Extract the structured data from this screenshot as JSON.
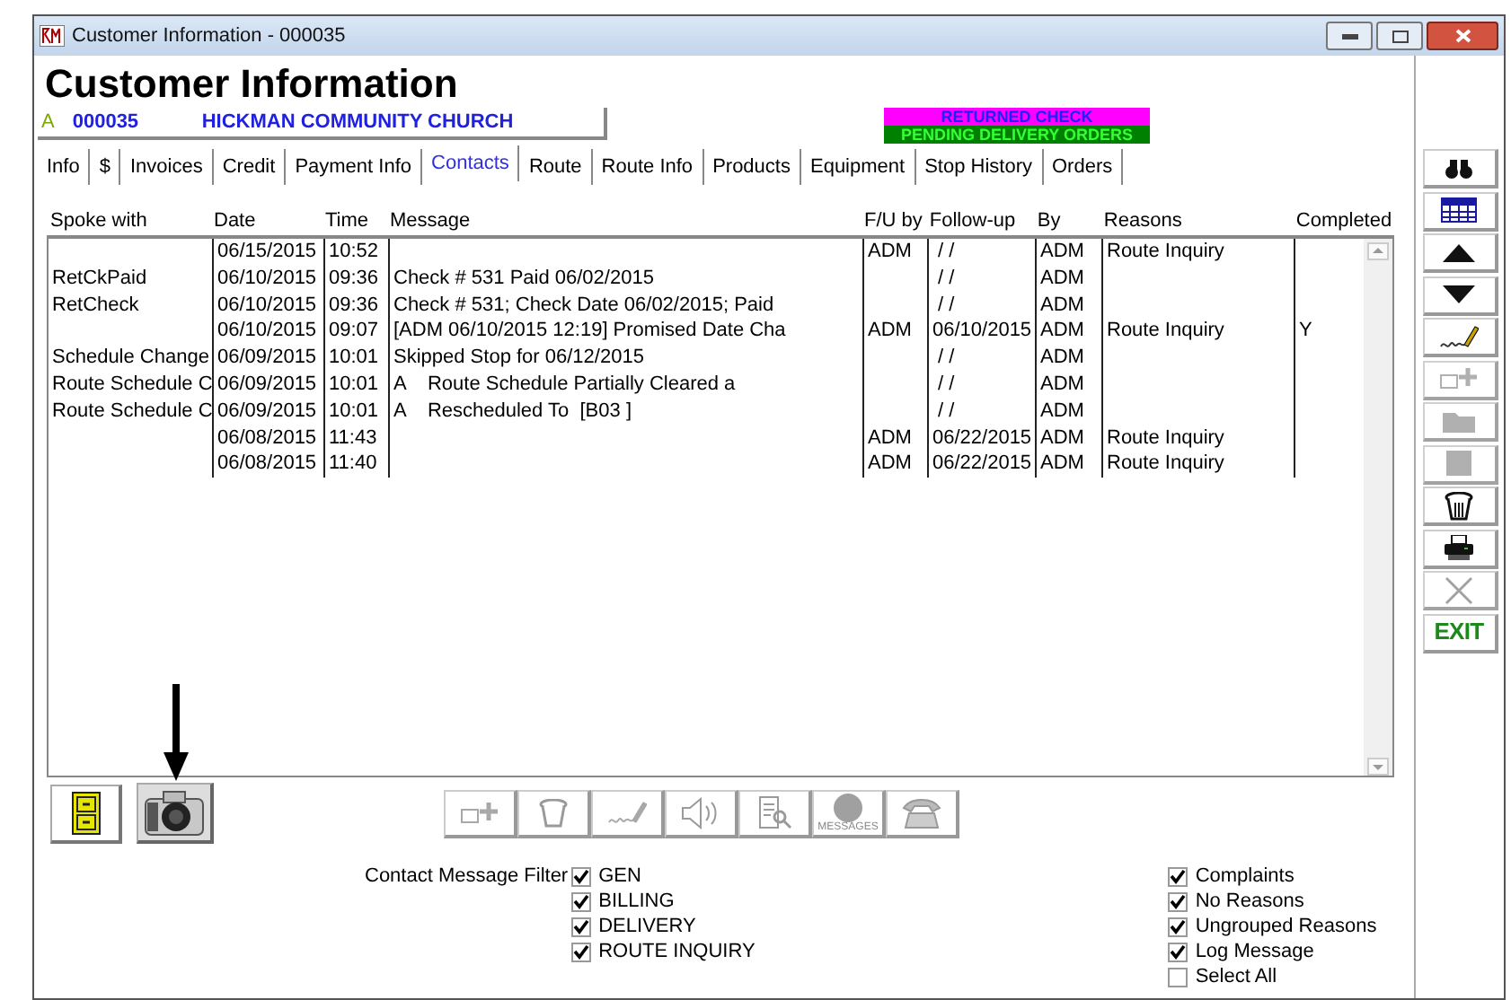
{
  "window": {
    "title": "Customer Information - 000035"
  },
  "heading": "Customer Information",
  "customer": {
    "status": "A",
    "number": "000035",
    "name": "HICKMAN COMMUNITY CHURCH"
  },
  "alerts": [
    {
      "text": "RETURNED CHECK",
      "kind": "returned"
    },
    {
      "text": "PENDING DELIVERY ORDERS",
      "kind": "pending"
    }
  ],
  "tabs": [
    {
      "label": "Info",
      "selected": false
    },
    {
      "label": "$",
      "selected": false
    },
    {
      "label": "Invoices",
      "selected": false
    },
    {
      "label": "Credit",
      "selected": false
    },
    {
      "label": "Payment Info",
      "selected": false
    },
    {
      "label": "Contacts",
      "selected": true
    },
    {
      "label": "Route",
      "selected": false
    },
    {
      "label": "Route Info",
      "selected": false
    },
    {
      "label": "Products",
      "selected": false
    },
    {
      "label": "Equipment",
      "selected": false
    },
    {
      "label": "Stop History",
      "selected": false
    },
    {
      "label": "Orders",
      "selected": false
    }
  ],
  "table": {
    "columns": [
      "Spoke with",
      "Date",
      "Time",
      "Message",
      "F/U by",
      "Follow-up",
      "By",
      "Reasons",
      "Completed"
    ],
    "rows": [
      [
        "",
        "06/15/2015",
        "10:52",
        "",
        "ADM",
        " / /",
        "ADM",
        "Route Inquiry",
        ""
      ],
      [
        "RetCkPaid",
        "06/10/2015",
        "09:36",
        "Check # 531 Paid 06/02/2015",
        "",
        " / /",
        "ADM",
        "",
        ""
      ],
      [
        "RetCheck",
        "06/10/2015",
        "09:36",
        "Check # 531; Check Date 06/02/2015; Paid",
        "",
        " / /",
        "ADM",
        "",
        ""
      ],
      [
        "",
        "06/10/2015",
        "09:07",
        "[ADM 06/10/2015 12:19] Promised Date Cha",
        "ADM",
        "06/10/2015",
        "ADM",
        "Route Inquiry",
        "Y"
      ],
      [
        "Schedule Change",
        "06/09/2015",
        "10:01",
        "Skipped Stop for 06/12/2015",
        "",
        " / /",
        "ADM",
        "",
        ""
      ],
      [
        "Route Schedule C",
        "06/09/2015",
        "10:01",
        "A    Route Schedule Partially Cleared a",
        "",
        " / /",
        "ADM",
        "",
        ""
      ],
      [
        "Route Schedule C",
        "06/09/2015",
        "10:01",
        "A    Rescheduled To  [B03 ]",
        "",
        " / /",
        "ADM",
        "",
        ""
      ],
      [
        "",
        "06/08/2015",
        "11:43",
        "",
        "ADM",
        "06/22/2015",
        "ADM",
        "Route Inquiry",
        ""
      ],
      [
        "",
        "06/08/2015",
        "11:40",
        "",
        "ADM",
        "06/22/2015",
        "ADM",
        "Route Inquiry",
        ""
      ]
    ]
  },
  "toolbar": [
    {
      "kind": "binoculars",
      "disabled": false
    },
    {
      "kind": "grid",
      "disabled": false
    },
    {
      "kind": "up",
      "disabled": false
    },
    {
      "kind": "down",
      "disabled": false
    },
    {
      "kind": "sign",
      "disabled": false
    },
    {
      "kind": "addnote",
      "disabled": true
    },
    {
      "kind": "folder",
      "disabled": true
    },
    {
      "kind": "stop",
      "disabled": true
    },
    {
      "kind": "trash",
      "disabled": false
    },
    {
      "kind": "print",
      "disabled": false
    },
    {
      "kind": "cancel",
      "disabled": true
    },
    {
      "kind": "exit",
      "disabled": false,
      "label": "EXIT"
    }
  ],
  "bottom_buttons": [
    {
      "kind": "addnote"
    },
    {
      "kind": "trash"
    },
    {
      "kind": "sign"
    },
    {
      "kind": "speaker"
    },
    {
      "kind": "search"
    },
    {
      "kind": "messages",
      "label": "MESSAGES"
    },
    {
      "kind": "phone"
    }
  ],
  "filter": {
    "label": "Contact Message Filter",
    "types": [
      {
        "label": "GEN",
        "checked": true
      },
      {
        "label": "BILLING",
        "checked": true
      },
      {
        "label": "DELIVERY",
        "checked": true
      },
      {
        "label": "ROUTE INQUIRY",
        "checked": true
      }
    ],
    "options": [
      {
        "label": "Complaints",
        "checked": true
      },
      {
        "label": "No Reasons",
        "checked": true
      },
      {
        "label": "Ungrouped Reasons",
        "checked": true
      },
      {
        "label": "Log Message",
        "checked": true
      },
      {
        "label": "Select All",
        "checked": false
      }
    ]
  }
}
